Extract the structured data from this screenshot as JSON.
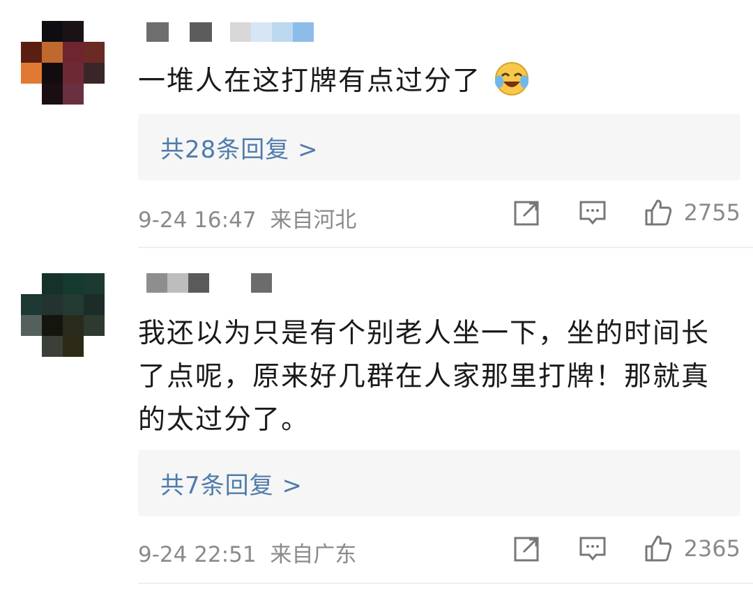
{
  "comments": [
    {
      "text": "一堆人在这打牌有点过分了",
      "emoji": "laughing-crying-emoji",
      "reply_label": "共28条回复 >",
      "date": "9-24 16:47",
      "location": "来自河北",
      "likes": "2755",
      "icons": [
        "share-icon",
        "comment-icon",
        "like-icon"
      ]
    },
    {
      "text_lines": [
        "我还以为只是有个别老人坐一下，坐的时间长",
        "了点呢，原来好几群在人家那里打牌！那就真",
        "的太过分了。"
      ],
      "reply_label": "共7条回复 >",
      "date": "9-24 22:51",
      "location": "来自广东",
      "likes": "2365",
      "icons": [
        "share-icon",
        "comment-icon",
        "like-icon"
      ]
    }
  ],
  "colors": {
    "link": "#4f7bab",
    "meta": "#8a8a8a",
    "reply_bg": "#f6f6f6"
  }
}
